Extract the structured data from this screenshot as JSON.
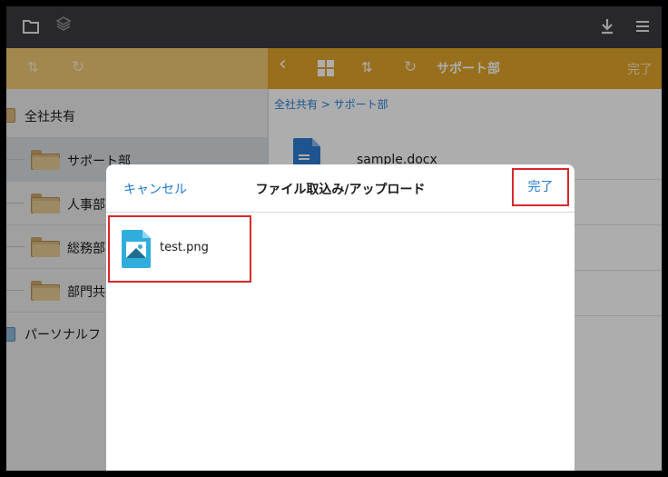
{
  "toolbar": {
    "folder_icon": "folder-icon",
    "layers_icon": "layers-icon",
    "download_icon": "download-icon",
    "menu_icon": "menu-icon"
  },
  "left_toolbar": {
    "sort_icon": "sort-icon",
    "refresh_icon": "refresh-icon"
  },
  "right_toolbar": {
    "back_icon": "back-icon",
    "grid_icon": "grid-icon",
    "sort_icon": "sort-icon",
    "refresh_icon": "refresh-icon",
    "title": "サポート部",
    "done": "完了"
  },
  "sidebar": {
    "root_label": "全社共有",
    "items": [
      {
        "label": "サポート部",
        "selected": true
      },
      {
        "label": "人事部",
        "selected": false
      },
      {
        "label": "総務部",
        "selected": false
      },
      {
        "label": "部門共",
        "selected": false
      }
    ],
    "personal_label": "パーソナルフ"
  },
  "main": {
    "breadcrumb": "全社共有 > サポート部",
    "files": [
      {
        "name": "sample.docx",
        "icon": "doc-icon"
      }
    ]
  },
  "modal": {
    "cancel": "キャンセル",
    "title": "ファイル取込み/アップロード",
    "done": "完了",
    "files": [
      {
        "name": "test.png",
        "icon": "image-file-icon"
      }
    ]
  },
  "colors": {
    "top_bar": "#3b3c41",
    "accent_orange": "#e1a42c",
    "light_orange": "#efc774",
    "link_blue": "#1f78d1",
    "highlight_red": "#d9262b"
  }
}
